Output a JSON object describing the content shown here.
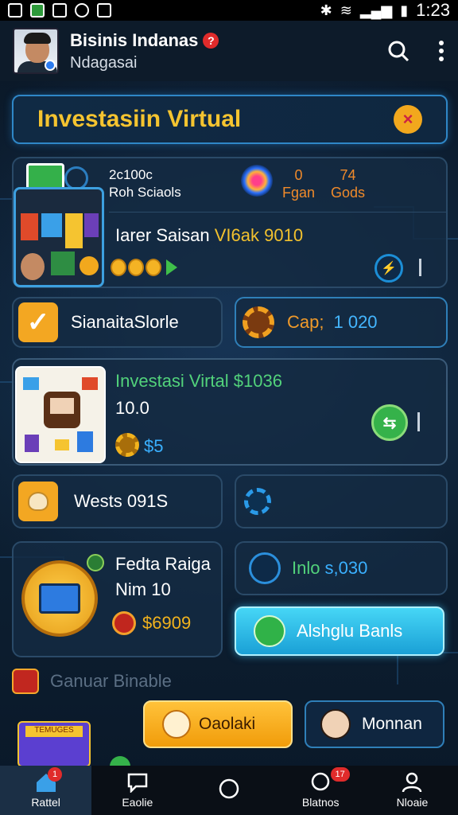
{
  "status": {
    "time": "1:23"
  },
  "header": {
    "name": "Bisinis Indanas",
    "subtitle": "Ndagasai"
  },
  "banner": {
    "title": "Investasiin Virtual"
  },
  "card1": {
    "stat_line1": "2c100c",
    "stat_line2": "Roh Sciaols",
    "num1_value": "0",
    "num1_label": "Fgan",
    "num2_value": "74",
    "num2_label": "Gods",
    "title_prefix": "Iarer Saisan",
    "title_highlight": "VI6ak 9010"
  },
  "card2a": {
    "label": "SianaitaSlorle"
  },
  "card2b": {
    "label": "Cap;",
    "value": "1 020"
  },
  "card3": {
    "title": "Investasi Virtal $1036",
    "value": "10.0",
    "price": "$5"
  },
  "card4a": {
    "label": "Wests 091S"
  },
  "card5a": {
    "title": "Fedta Raiga",
    "sub": "Nim 10",
    "price": "$6909"
  },
  "card5b": {
    "label": "Inlo",
    "value": "s,030"
  },
  "cta": {
    "label": "Alshglu Banls"
  },
  "section": {
    "title": "Ganuar Binable",
    "btn_orange": "Oaolaki",
    "btn_dark": "Monnan",
    "promo_tag": "TEMUGES"
  },
  "nav": [
    {
      "label": "Rattel",
      "badge": "1"
    },
    {
      "label": "Eaolie",
      "badge": ""
    },
    {
      "label": "",
      "badge": ""
    },
    {
      "label": "Blatnos",
      "badge": "17"
    },
    {
      "label": "Nloaie",
      "badge": ""
    }
  ],
  "colors": {
    "accent_gold": "#f5c430",
    "accent_blue": "#2f87c7",
    "accent_green": "#52d27b"
  }
}
